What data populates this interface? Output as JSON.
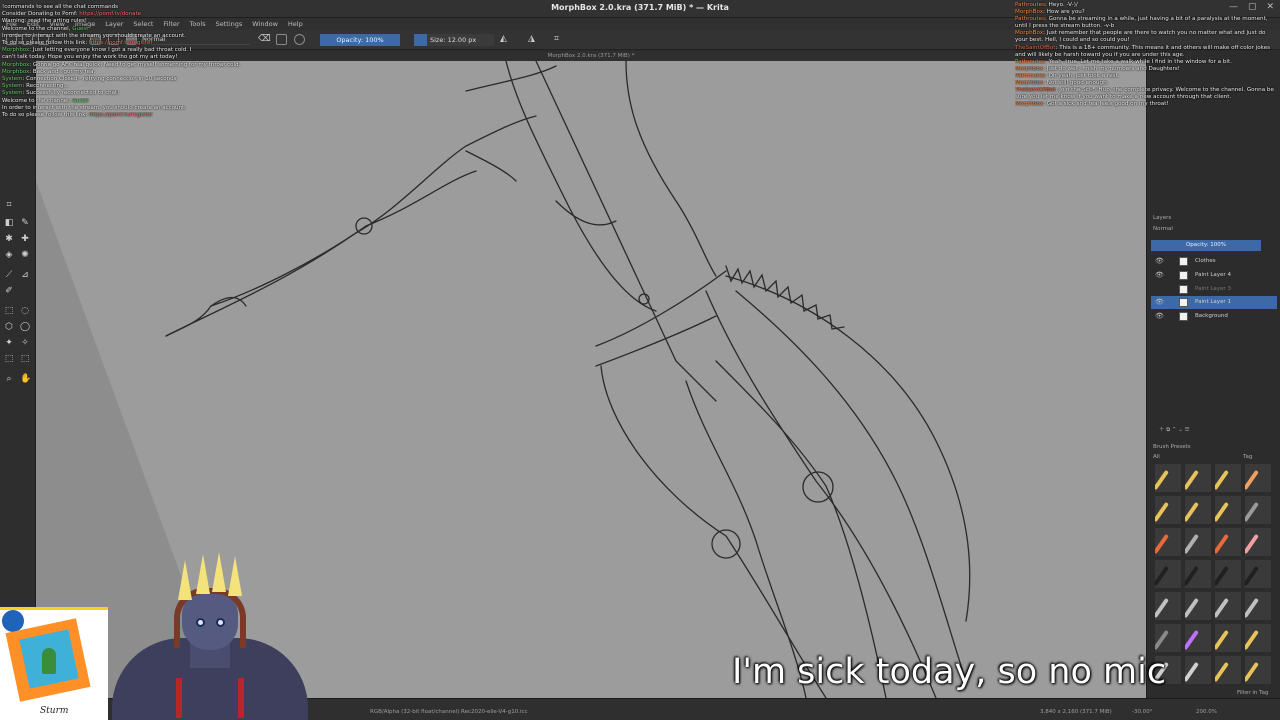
{
  "window": {
    "title": "MorphBox 2.0.kra (371.7 MiB) * — Krita",
    "document_tab": "MorphBox 2.0.kra (371.7 MiB) *"
  },
  "menu": [
    "File",
    "Edit",
    "View",
    "Image",
    "Layer",
    "Select",
    "Filter",
    "Tools",
    "Settings",
    "Window",
    "Help"
  ],
  "tool_options": {
    "blend_mode": "Normal",
    "opacity": "Opacity: 100%",
    "size": "Size: 12.00 px"
  },
  "layers": {
    "panel_title": "Layers",
    "blend_mode": "Normal",
    "opacity": "Opacity: 100%",
    "items": [
      {
        "name": "Clothes",
        "active": false,
        "dim": false
      },
      {
        "name": "Paint Layer 4",
        "active": false,
        "dim": false
      },
      {
        "name": "Paint Layer 3",
        "active": false,
        "dim": true
      },
      {
        "name": "Paint Layer 1",
        "active": true,
        "dim": false
      },
      {
        "name": "Background",
        "active": false,
        "dim": false
      }
    ]
  },
  "brush_presets": {
    "panel_title": "Brush Presets",
    "filter": "All",
    "tag": "Tag",
    "filter_in_tag": "Filter in Tag",
    "colors": [
      "#e8c35a",
      "#e8c35a",
      "#e8c35a",
      "#f0a060",
      "#e8c35a",
      "#e8c35a",
      "#e8c35a",
      "#9a9a9a",
      "#e86a3a",
      "#b0b0b0",
      "#e86a3a",
      "#f0a0a0",
      "#202020",
      "#202020",
      "#202020",
      "#202020",
      "#c0c0c0",
      "#c0c0c0",
      "#c0c0c0",
      "#c0c0c0",
      "#8a8a8a",
      "#c070ff",
      "#e8c35a",
      "#e8c35a",
      "#d0d0d0",
      "#d0d0d0",
      "#e8c35a",
      "#e8c35a"
    ]
  },
  "statusbar": {
    "format": "RGB/Alpha (32-bit float/channel)  Rec2020-elle-V4-g10.icc",
    "dimensions": "3,840 x 2,160 (371.7 MiB)",
    "rotation": "-30.00°",
    "zoom": "200.0%"
  },
  "chat_left": [
    {
      "name": "",
      "text": "!commands to see all the chat commands",
      "type": "bot"
    },
    {
      "name": "",
      "text": "Consider Donating to Pomf: ",
      "link": "https://pomf.tv/donate",
      "type": "bot"
    },
    {
      "name": "",
      "text": "Warning: read the arting rules!",
      "type": "bot"
    },
    {
      "name": "Guest",
      "text": "Welcome to the channel, ",
      "type": "sys"
    },
    {
      "name": "",
      "text": "In order to interact with the stream, you should create an account.",
      "type": "sys"
    },
    {
      "name": "",
      "text": "To do so please follow this link: ",
      "link": "https://pomf.tv/register",
      "type": "sys"
    },
    {
      "name": "Morphbox",
      "text": "Just letting everyone know I got a really bad throat cold. I",
      "type": "user"
    },
    {
      "name": "",
      "text": "can't talk today. Hope you enjoy the work tho got my art today!",
      "type": "user"
    },
    {
      "name": "Morphbox",
      "text": "Gonna go AFK real quick. Need to get myself something for my throat cold.",
      "type": "user"
    },
    {
      "name": "Morphbox",
      "text": "Back and I got my tea.",
      "type": "user"
    },
    {
      "name": "System",
      "text": "Connection Closed - retrying connection in 10 seconds",
      "type": "sys"
    },
    {
      "name": "System",
      "text": "Reconnecting...",
      "type": "sys"
    },
    {
      "name": "System",
      "text": "Successfully reconnected to chat!",
      "type": "sys"
    },
    {
      "name": "Guest",
      "text": "Welcome to the channel, ",
      "type": "sys"
    },
    {
      "name": "",
      "text": "In order to interact with the stream, you should create an account.",
      "type": "sys"
    },
    {
      "name": "",
      "text": "To do so please follow this link: ",
      "link": "https://pomf.tv/register",
      "type": "sys"
    }
  ],
  "chat_right": [
    {
      "name": "Pathroutes",
      "text": "Heyo. -V-)/"
    },
    {
      "name": "MorphBox",
      "text": "How are you?"
    },
    {
      "name": "Pathroutes",
      "text": "Gonna be streaming in a while, just having a bit of a paralysis at the moment, until I press the stream button. -v-b"
    },
    {
      "name": "MorphBox",
      "text": "Just remember that people are there to watch you no matter what and just do your best. Hell, I could and so could you!"
    },
    {
      "name": "TheSaintOfBot",
      "text": "This is a 18+ community. This means it and others will make off color jokes and will likely be harsh toward you if you are under this age."
    },
    {
      "name": "Pathroutes",
      "text": "Yeah, true. Let me take a walk while I find in the window for a bit."
    },
    {
      "name": "MorphBox",
      "text": "Just do well, finish my numbers and Daughters!"
    },
    {
      "name": "Pathroutes",
      "text": "Oh yeah, just took a rest."
    },
    {
      "name": "MorphBox",
      "text": "Not still good enough."
    },
    {
      "name": "TheSaintOfBot",
      "text": "Join the Sci-Fi Hub, the complete privacy. Welcome to the channel. Gonna be sure you let me know if you want to make a new account through that client."
    },
    {
      "name": "MorphBox",
      "text": "Got a sick and tea feels good on my throat!"
    }
  ],
  "caption": "I'm sick today, so no mic",
  "logo_signature": "Sturm"
}
